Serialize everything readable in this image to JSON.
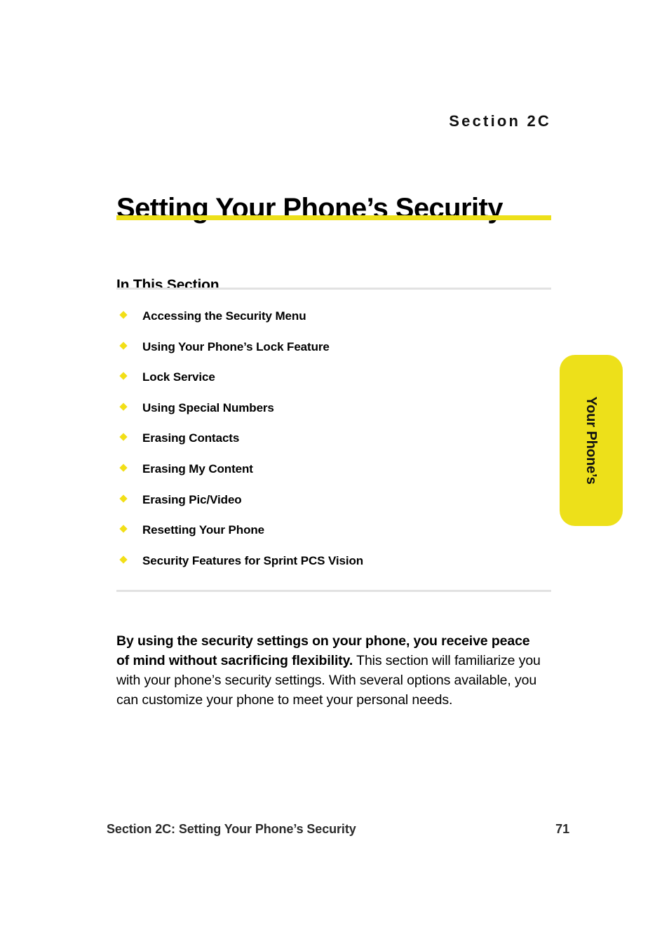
{
  "header": {
    "section_eyebrow": "Section 2C",
    "title": "Setting Your Phone’s Security",
    "rule_color": "#EDE01A"
  },
  "in_this_section": {
    "heading": "In This Section",
    "bullet_color": "#F2DF17",
    "items": [
      {
        "label": "Accessing the Security Menu"
      },
      {
        "label": "Using Your Phone’s Lock Feature"
      },
      {
        "label": "Lock Service"
      },
      {
        "label": "Using Special Numbers"
      },
      {
        "label": "Erasing Contacts"
      },
      {
        "label": "Erasing My Content"
      },
      {
        "label": "Erasing Pic/Video"
      },
      {
        "label": "Resetting Your Phone"
      },
      {
        "label": "Security Features for Sprint PCS Vision"
      }
    ]
  },
  "intro": {
    "lead": "By using the security settings on your phone, you receive peace of mind without sacrificing flexibility.",
    "body": " This section will familiarize you with your phone’s security settings. With several options available, you can customize your phone to meet your personal needs."
  },
  "side_tab": {
    "label": "Your Phone’s",
    "background_color": "#EDE01A"
  },
  "footer": {
    "left": "Section 2C: Setting Your Phone’s Security",
    "page_number": "71"
  }
}
